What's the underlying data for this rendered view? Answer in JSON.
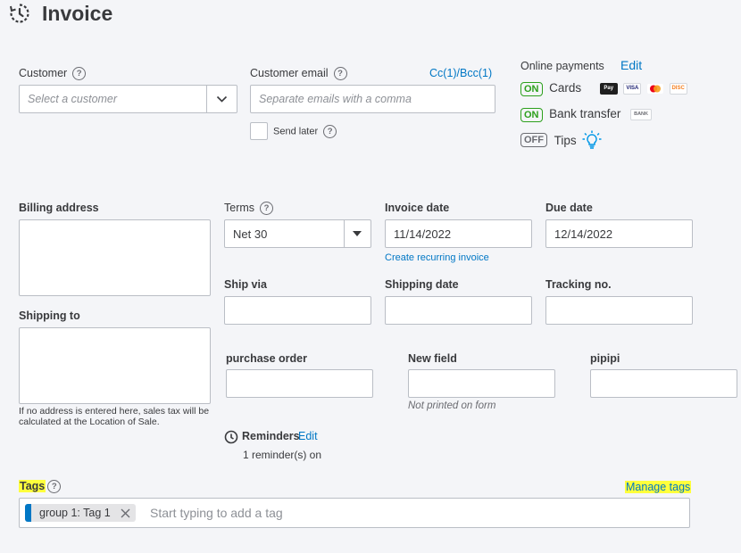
{
  "header": {
    "title": "Invoice"
  },
  "customer": {
    "label": "Customer",
    "placeholder": "Select a customer"
  },
  "email": {
    "label": "Customer email",
    "cc_bcc": "Cc(1)/Bcc(1)",
    "placeholder": "Separate emails with a comma",
    "send_later": "Send later"
  },
  "online_payments": {
    "label": "Online payments",
    "edit": "Edit",
    "items": [
      {
        "state": "ON",
        "label": "Cards"
      },
      {
        "state": "ON",
        "label": "Bank transfer",
        "badge": "BANK"
      },
      {
        "state": "OFF",
        "label": "Tips"
      }
    ]
  },
  "billing_address": {
    "label": "Billing address",
    "value": ""
  },
  "shipping_to": {
    "label": "Shipping to",
    "note": "If no address is entered here, sales tax will be calculated at the Location of Sale."
  },
  "terms": {
    "label": "Terms",
    "value": "Net 30"
  },
  "invoice_date": {
    "label": "Invoice date",
    "value": "11/14/2022",
    "link": "Create recurring invoice"
  },
  "due_date": {
    "label": "Due date",
    "value": "12/14/2022"
  },
  "ship_via": {
    "label": "Ship via"
  },
  "shipping_date": {
    "label": "Shipping date"
  },
  "tracking_no": {
    "label": "Tracking no."
  },
  "custom_fields": {
    "purchase_order": {
      "label": "purchase order"
    },
    "new_field": {
      "label": "New field",
      "note": "Not printed on form"
    },
    "pipipi": {
      "label": "pipipi"
    }
  },
  "reminders": {
    "label": "Reminders",
    "edit": "Edit",
    "status": "1 reminder(s) on"
  },
  "tags": {
    "label": "Tags",
    "manage": "Manage tags",
    "chip": "group 1: Tag 1",
    "placeholder": "Start typing to add a tag"
  },
  "colors": {
    "accent": "#0077c5",
    "green": "#2ca01c",
    "highlight": "#ffff3c"
  }
}
